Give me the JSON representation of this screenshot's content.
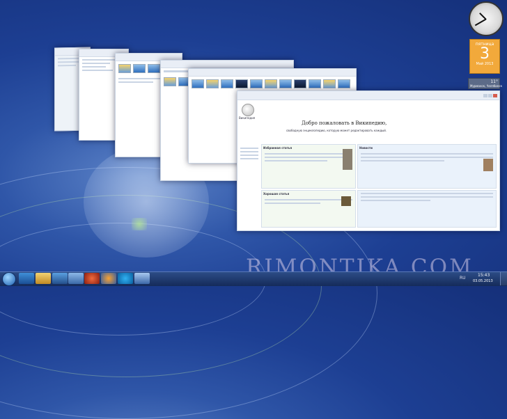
{
  "desktop": {
    "watermark": "RIMONTIKA.COM"
  },
  "windows": {
    "explorer_title": "",
    "images_title": "",
    "browser_url": "",
    "wiki_logo_text": "Википедия",
    "wiki_welcome": "Добро пожаловать в Википедию,",
    "wiki_sub": "свободную энциклопедию, которую может редактировать каждый.",
    "wiki_featured_heading": "Избранная статья",
    "wiki_good_heading": "Хорошая статья",
    "wiki_news_heading": "Новости"
  },
  "gadgets": {
    "calendar_day_name": "пятница",
    "calendar_day": "3",
    "calendar_month": "Май 2013",
    "weather_city": "Мурманск, Челябинск",
    "weather_temp": "11°"
  },
  "taskbar": {
    "time": "15:43",
    "date": "03.05.2013",
    "lang": "RU"
  }
}
